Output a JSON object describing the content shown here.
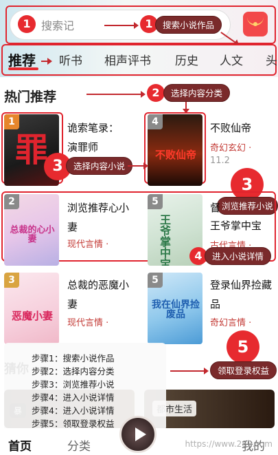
{
  "header": {
    "search_placeholder": "搜索记",
    "gift_icon": "red-envelope-icon"
  },
  "tabs": [
    {
      "label": "推荐",
      "active": true
    },
    {
      "label": "听书"
    },
    {
      "label": "相声评书"
    },
    {
      "label": "历史"
    },
    {
      "label": "人文"
    },
    {
      "label": "头"
    }
  ],
  "section": {
    "title": "热门推荐"
  },
  "books": [
    {
      "rank": "1",
      "title": "诡索笔录：演罪师",
      "genre": "",
      "cover_text": "罪",
      "rank_color": "#e6862c"
    },
    {
      "rank": "4",
      "title": "不败仙帝",
      "genre": "奇幻玄幻 ·",
      "extra": "11.2",
      "cover_text": "不败仙帝",
      "rank_color": "#8a8a8a"
    },
    {
      "rank": "2",
      "title": "浏览推荐心小妻",
      "genre": "现代言情 ·",
      "cover_text": "总裁的心小妻",
      "rank_color": "#8a8a8a"
    },
    {
      "rank": "5",
      "title": "王爷掌中宝",
      "title_prefix": "督",
      "genre": "古代言情 ·",
      "cover_text": "王爷掌中宝",
      "rank_color": "#8a8a8a"
    },
    {
      "rank": "3",
      "title": "总裁的恶魔小妻",
      "genre": "现代言情 ·",
      "cover_text": "恶魔小妻",
      "rank_color": "#d9a441"
    },
    {
      "rank": "5",
      "title": "登录仙界捡藏品",
      "genre": "奇幻言情 ·",
      "cover_text": "我在仙界捡废品",
      "rank_color": "#8a8a8a"
    }
  ],
  "annotations": {
    "a1_badge": "1",
    "a1_badge2": "1",
    "a1_label": "搜索小说作品",
    "a2_badge": "2",
    "a2_label": "选择内容分类",
    "a3_badge": "3",
    "a3_label": "选择内容小说",
    "a3b_badge": "3",
    "a3b_label": "浏览推荐小说",
    "a4_badge": "4",
    "a4_label": "进入小说详情",
    "a5_badge": "5",
    "a5_label": "领取登录权益"
  },
  "steps": [
    "步骤1：搜索小说作品",
    "步骤2：选择内容分类",
    "步骤3：浏览推荐小说",
    "步骤4：进入小说详情",
    "步骤4：进入小说详情",
    "步骤5：领取登录权益"
  ],
  "guess_section": {
    "title": "猜你"
  },
  "banners": [
    {
      "label": "暴"
    },
    {
      "label": "都市生活"
    }
  ],
  "bottom_nav": {
    "home": "首页",
    "category": "分类",
    "mine": "我的"
  },
  "watermark": "https://www.289.com",
  "colors": {
    "accent": "#e72a2f",
    "annotation_pill": "#7a2a2b",
    "genre": "#c33a35"
  }
}
